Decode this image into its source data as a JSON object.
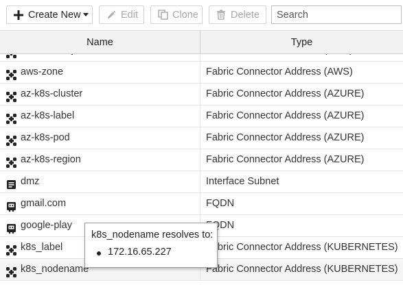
{
  "toolbar": {
    "create_label": "Create New",
    "edit_label": "Edit",
    "clone_label": "Clone",
    "delete_label": "Delete",
    "search_placeholder": "Search"
  },
  "table": {
    "columns": [
      "Name",
      "Type"
    ],
    "rows": [
      {
        "name": "aws-security",
        "type": "Fabric Connector Address (AWS)",
        "icon": "fabric-connector-icon"
      },
      {
        "name": "aws-zone",
        "type": "Fabric Connector Address (AWS)",
        "icon": "fabric-connector-icon"
      },
      {
        "name": "az-k8s-cluster",
        "type": "Fabric Connector Address (AZURE)",
        "icon": "fabric-connector-icon"
      },
      {
        "name": "az-k8s-label",
        "type": "Fabric Connector Address (AZURE)",
        "icon": "fabric-connector-icon"
      },
      {
        "name": "az-k8s-pod",
        "type": "Fabric Connector Address (AZURE)",
        "icon": "fabric-connector-icon"
      },
      {
        "name": "az-k8s-region",
        "type": "Fabric Connector Address (AZURE)",
        "icon": "fabric-connector-icon"
      },
      {
        "name": "dmz",
        "type": "Interface Subnet",
        "icon": "interface-subnet-icon"
      },
      {
        "name": "gmail.com",
        "type": "FQDN",
        "icon": "fqdn-icon"
      },
      {
        "name": "google-play",
        "type": "FQDN",
        "icon": "fqdn-icon"
      },
      {
        "name": "k8s_label",
        "type": "Fabric Connector Address (KUBERNETES)",
        "icon": "fabric-connector-icon"
      },
      {
        "name": "k8s_nodename",
        "type": "Fabric Connector Address (KUBERNETES)",
        "icon": "fabric-connector-icon"
      }
    ]
  },
  "tooltip": {
    "title": "k8s_nodename resolves to:",
    "items": [
      "172.16.65.227"
    ]
  }
}
